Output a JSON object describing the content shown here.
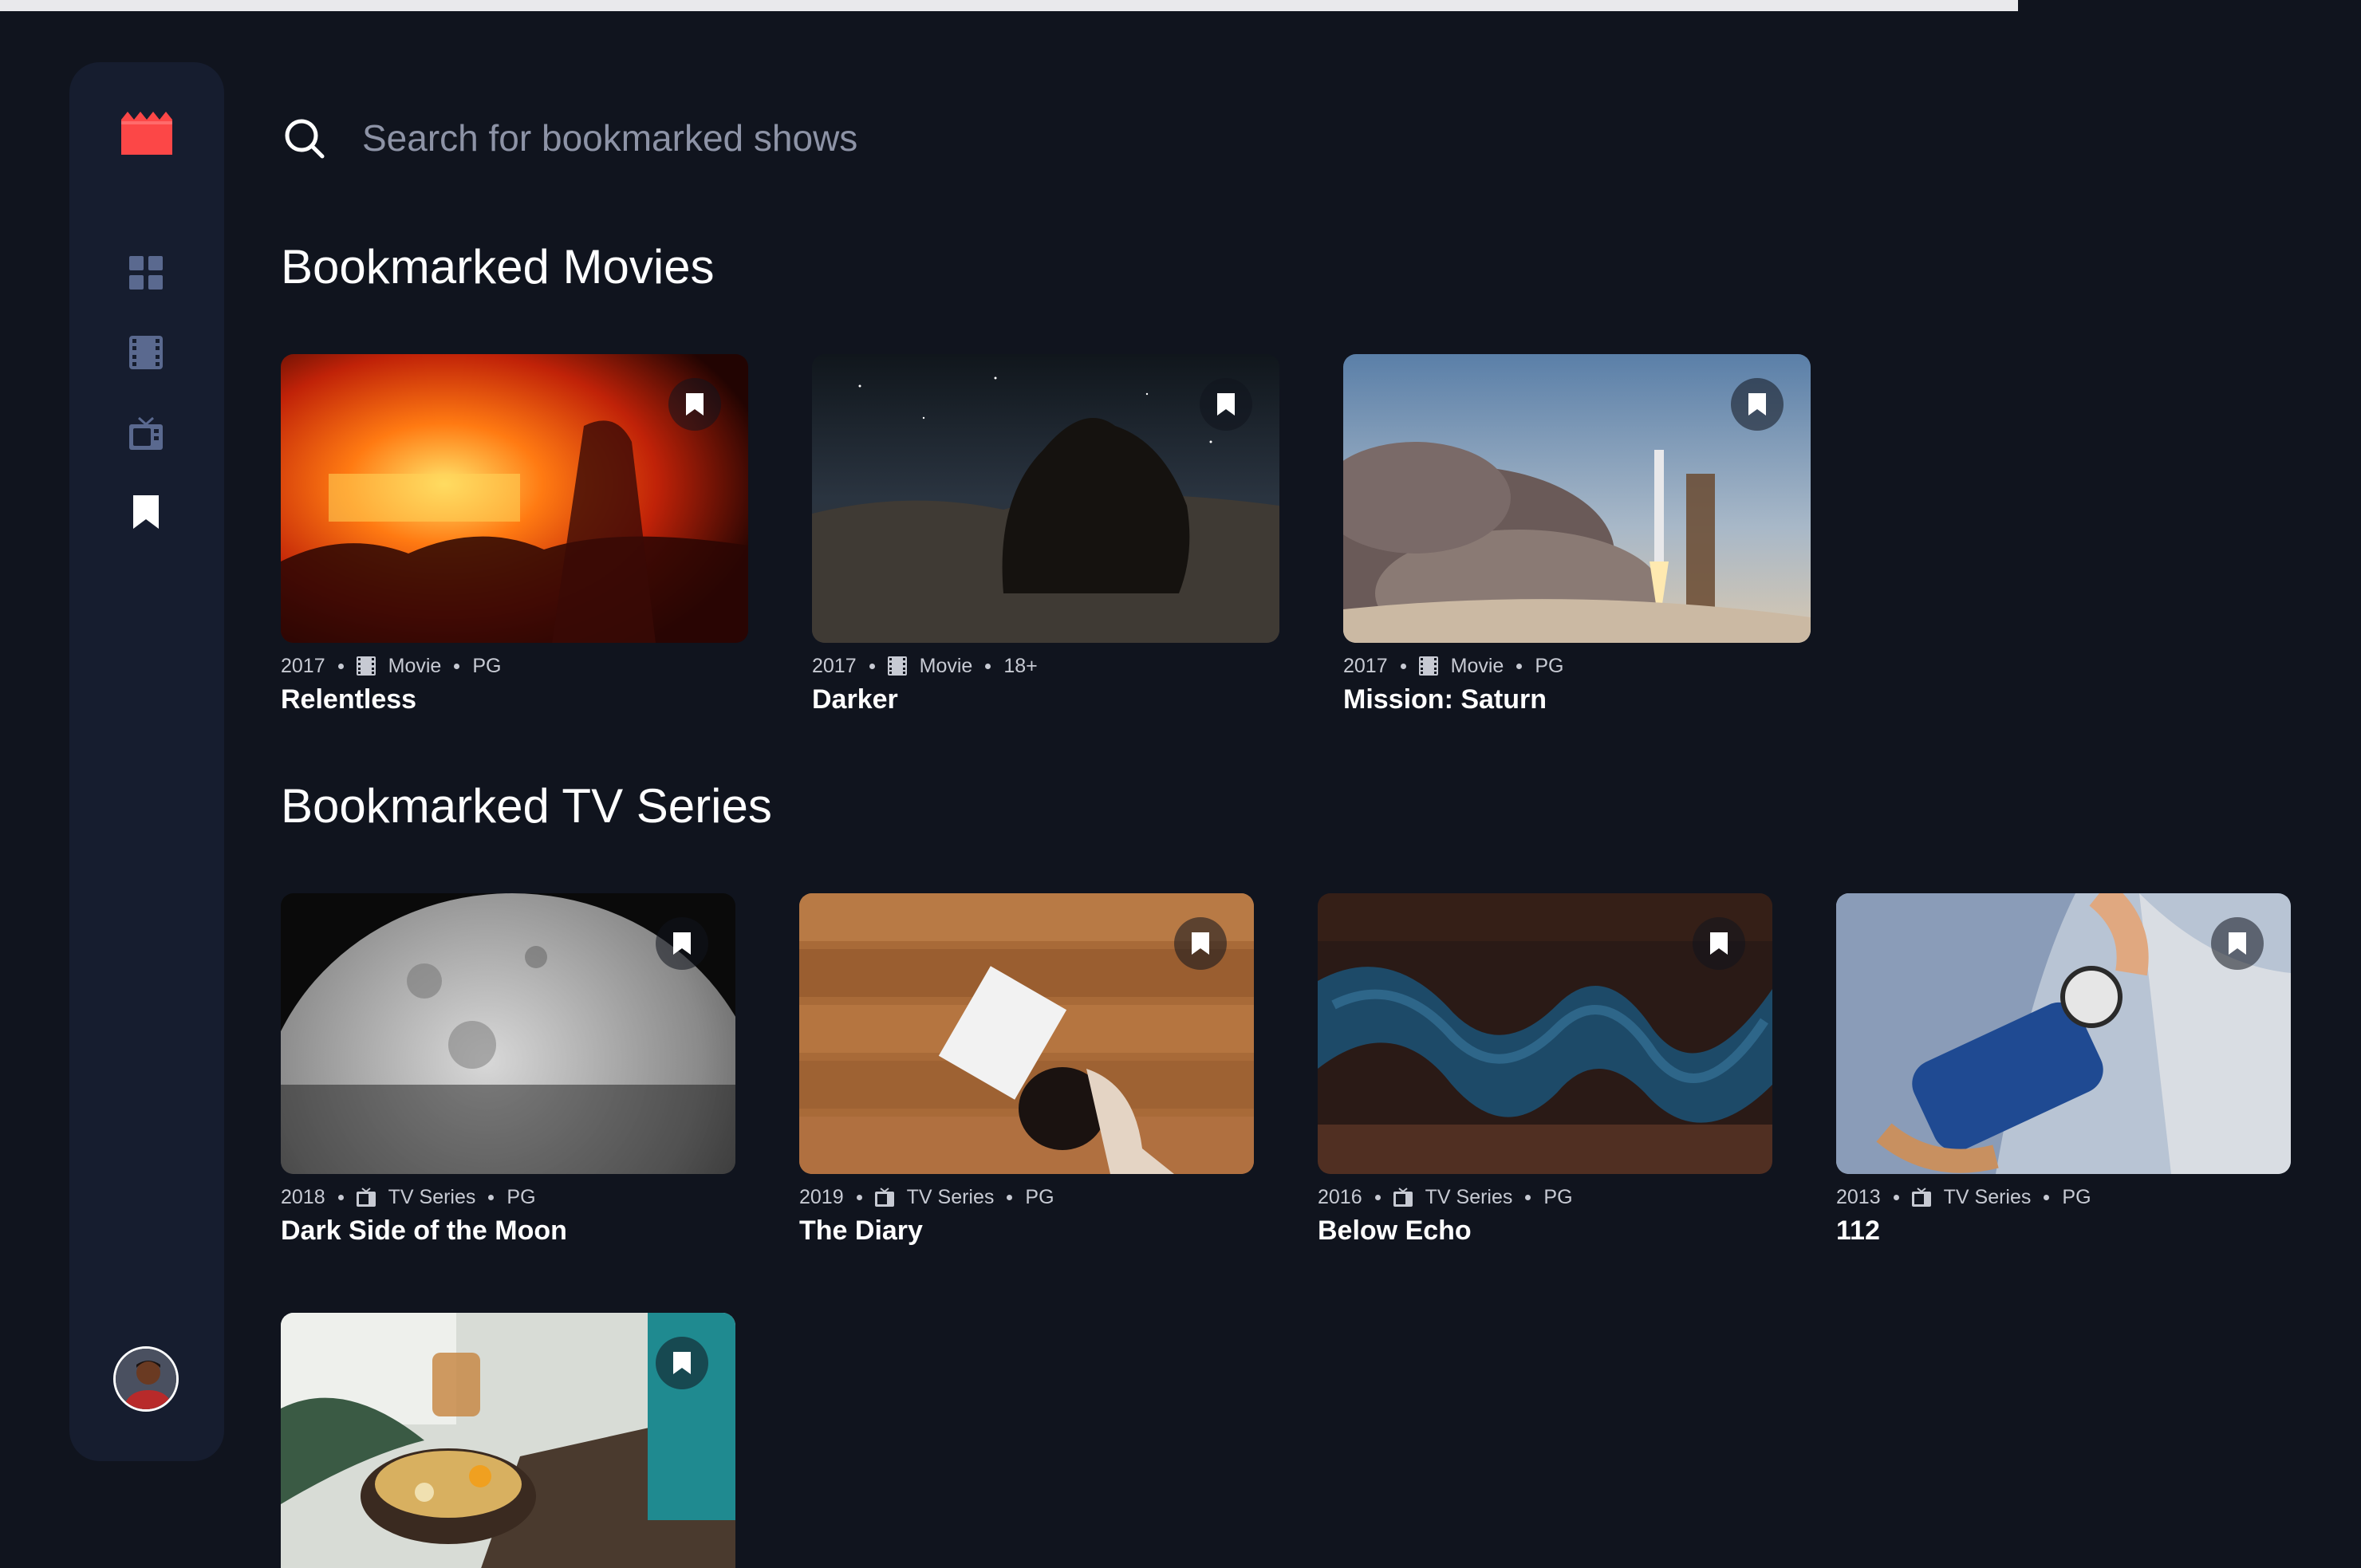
{
  "search": {
    "placeholder": "Search for bookmarked shows"
  },
  "sections": {
    "movies": {
      "title": "Bookmarked Movies"
    },
    "series": {
      "title": "Bookmarked TV Series"
    }
  },
  "movies": [
    {
      "year": "2017",
      "category": "Movie",
      "rating": "PG",
      "title": "Relentless"
    },
    {
      "year": "2017",
      "category": "Movie",
      "rating": "18+",
      "title": "Darker"
    },
    {
      "year": "2017",
      "category": "Movie",
      "rating": "PG",
      "title": "Mission: Saturn"
    }
  ],
  "series": [
    {
      "year": "2018",
      "category": "TV Series",
      "rating": "PG",
      "title": "Dark Side of the Moon"
    },
    {
      "year": "2019",
      "category": "TV Series",
      "rating": "PG",
      "title": "The Diary"
    },
    {
      "year": "2016",
      "category": "TV Series",
      "rating": "PG",
      "title": "Below Echo"
    },
    {
      "year": "2013",
      "category": "TV Series",
      "rating": "PG",
      "title": "112"
    }
  ],
  "nav": {
    "items": [
      "home-grid-icon",
      "movies-film-icon",
      "tv-series-icon",
      "bookmark-icon"
    ],
    "active": "bookmark-icon"
  },
  "colors": {
    "background": "#10141e",
    "sidebar": "#161d2f",
    "accent": "#fc4747",
    "muted": "#5a698f"
  }
}
